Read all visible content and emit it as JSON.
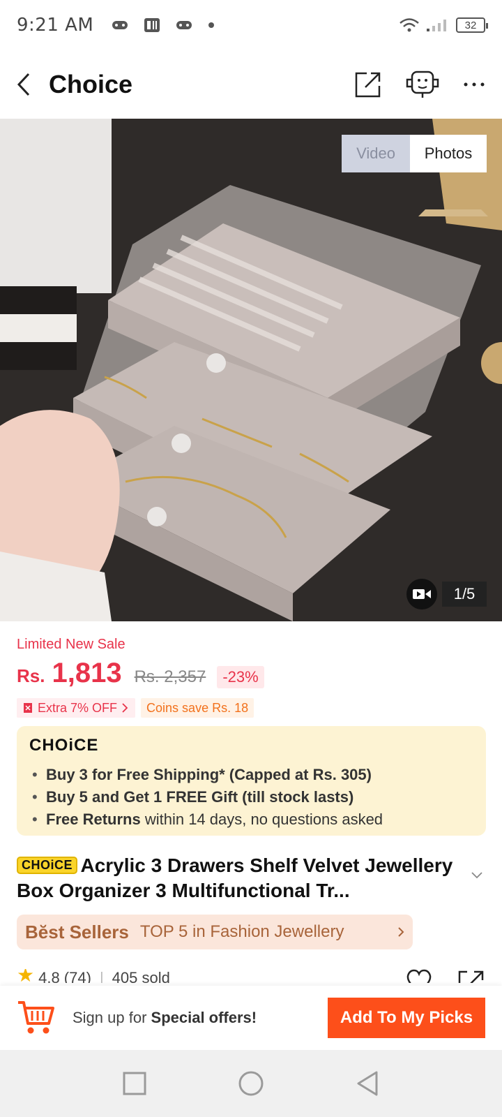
{
  "status_bar": {
    "time": "9:21 AM",
    "battery": "32"
  },
  "header": {
    "title": "Choice"
  },
  "gallery": {
    "toggle_video": "Video",
    "toggle_photos": "Photos",
    "counter": "1/5"
  },
  "price": {
    "label": "Limited New Sale",
    "currency": "Rs.",
    "current": "1,813",
    "original": "Rs. 2,357",
    "discount": "-23%"
  },
  "promos": {
    "extra": "Extra 7% OFF",
    "coins": "Coins save Rs. 18"
  },
  "choice": {
    "logo": "CHOiCE",
    "items": [
      {
        "bold": "Buy 3 for  Free Shipping* (Capped at Rs. 305)",
        "rest": ""
      },
      {
        "bold": "Buy 5 and Get 1 FREE Gift (till stock lasts)",
        "rest": ""
      },
      {
        "bold": "Free Returns",
        "rest": " within 14 days, no questions asked"
      }
    ]
  },
  "product": {
    "badge": "CHOiCE",
    "title": "Acrylic 3 Drawers Shelf Velvet Jewellery Box Organizer 3 Multifunctional Tr..."
  },
  "best_sellers": {
    "logo": "Bĕst Sellers",
    "text": "TOP 5 in Fashion Jewellery"
  },
  "rating": {
    "value": "4.8 (74)",
    "sold": "405 sold"
  },
  "bottom_bar": {
    "signup_prefix": "Sign up for ",
    "signup_bold": "Special offers!",
    "button": "Add To My Picks"
  },
  "colors": {
    "accent_red": "#e8334a",
    "button_orange": "#fd4f1a",
    "choice_bg": "#fdf3d3",
    "best_sellers_bg": "#fbe6db"
  }
}
